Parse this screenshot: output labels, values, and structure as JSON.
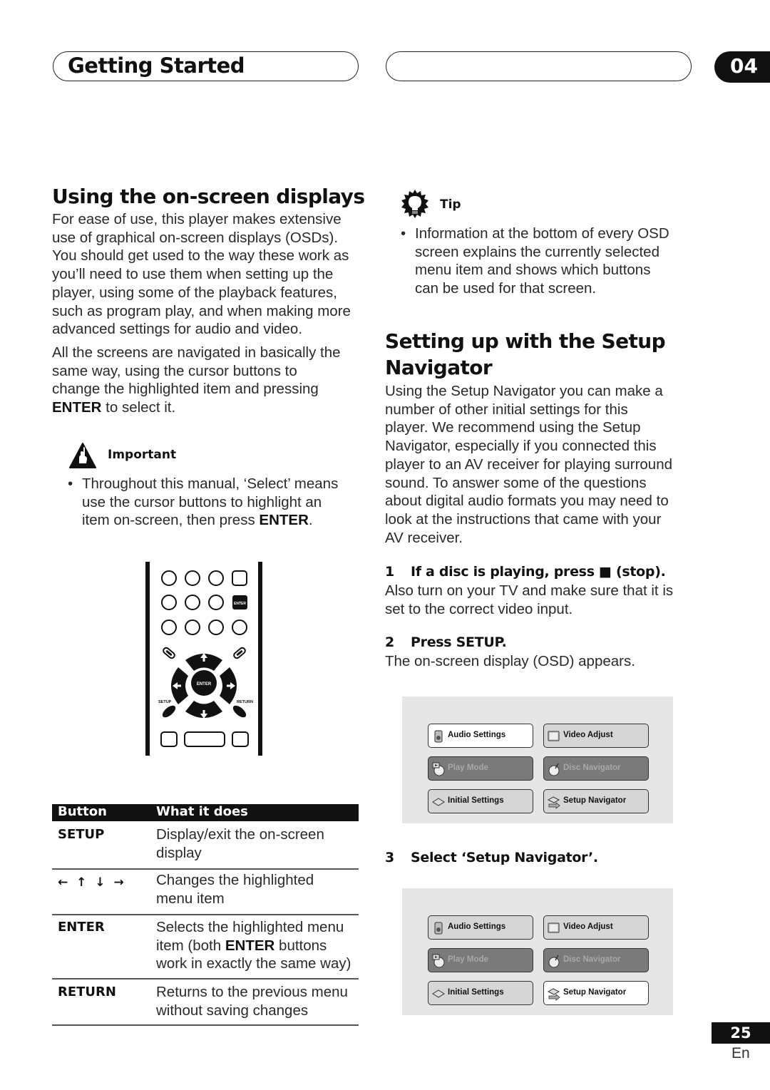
{
  "header": {
    "section_title": "Getting Started",
    "chapter_number": "04"
  },
  "left": {
    "heading": "Using the on-screen displays",
    "para1": "For ease of use, this player makes extensive use of graphical on-screen displays (OSDs). You should get used to the way these work as you’ll need to use them when setting up the player, using some of the playback features, such as program play, and when making more advanced settings for audio and video.",
    "para2_lines": [
      "All the screens are navigated in basically the",
      "same way, using the cursor buttons to",
      "change the highlighted item and pressing"
    ],
    "para2_enter": "ENTER",
    "para2_tail": " to select it.",
    "important_icon": "warning-hand-icon",
    "important_label": "Important",
    "important_bullet": {
      "line1": "Throughout this manual, ‘Select’ means",
      "line2": "use the cursor buttons to highlight an",
      "line3_pre": "item on-screen, then press ",
      "line3_bold": "ENTER",
      "line3_post": "."
    },
    "remote": {
      "enter_small_label": "ENTER",
      "enter_center_label": "ENTER",
      "setup_label": "SETUP",
      "return_label": "RETURN"
    },
    "table": {
      "headers": [
        "Button",
        "What it does"
      ],
      "rows": [
        {
          "key": "SETUP",
          "lines": [
            "Display/exit the on-screen",
            "display"
          ]
        },
        {
          "key": "arrows",
          "key_symbols": "← ↑ ↓ →",
          "lines": [
            "Changes the highlighted",
            "menu item"
          ]
        },
        {
          "key": "ENTER",
          "line1": "Selects the highlighted menu",
          "line2_pre": "item (both ",
          "line2_bold": "ENTER",
          "line2_post": " buttons",
          "line3": "work in exactly the same way)"
        },
        {
          "key": "RETURN",
          "lines": [
            "Returns to the previous menu",
            "without saving changes"
          ]
        }
      ]
    }
  },
  "right": {
    "tip_icon": "lightbulb-icon",
    "tip_label": "Tip",
    "tip_bullet": [
      "Information at the bottom of every OSD",
      "screen explains the currently selected",
      "menu item and shows which buttons",
      "can be used for that screen."
    ],
    "heading_line1": "Setting up with the Setup",
    "heading_line2": "Navigator",
    "intro": [
      "Using the Setup Navigator you can make a",
      "number of other initial settings for this",
      "player. We recommend using the Setup",
      "Navigator, especially if you connected this",
      "player to an AV receiver for playing surround",
      "sound. To answer some of the questions",
      "about digital audio formats you may need to",
      "look at the instructions that came with your",
      "AV receiver."
    ],
    "step1": {
      "num": "1",
      "title_pre": "If a disc is playing, press ",
      "title_symbol": "■",
      "title_post": " (stop).",
      "body": [
        "Also turn on your TV and make sure that it is",
        "set to the correct video input."
      ]
    },
    "step2": {
      "num": "2",
      "title": "Press SETUP.",
      "body": [
        "The on-screen display (OSD) appears."
      ]
    },
    "step3": {
      "num": "3",
      "title": "Select ‘Setup Navigator’."
    },
    "osd1": {
      "items": [
        {
          "label": "Audio Settings",
          "icon": "speaker-icon",
          "state": "selected"
        },
        {
          "label": "Video Adjust",
          "icon": "monitor-icon",
          "state": "normal"
        },
        {
          "label": "Play Mode",
          "icon": "disc-play-icon",
          "state": "disabled"
        },
        {
          "label": "Disc Navigator",
          "icon": "disc-navigator-icon",
          "state": "disabled"
        },
        {
          "label": "Initial Settings",
          "icon": "player-icon",
          "state": "normal"
        },
        {
          "label": "Setup Navigator",
          "icon": "setup-navigator-icon",
          "state": "normal"
        }
      ]
    },
    "osd2": {
      "items": [
        {
          "label": "Audio Settings",
          "icon": "speaker-icon",
          "state": "normal"
        },
        {
          "label": "Video Adjust",
          "icon": "monitor-icon",
          "state": "normal"
        },
        {
          "label": "Play Mode",
          "icon": "disc-play-icon",
          "state": "disabled"
        },
        {
          "label": "Disc Navigator",
          "icon": "disc-navigator-icon",
          "state": "disabled"
        },
        {
          "label": "Initial Settings",
          "icon": "player-icon",
          "state": "normal"
        },
        {
          "label": "Setup Navigator",
          "icon": "setup-navigator-icon",
          "state": "selected"
        }
      ]
    }
  },
  "footer": {
    "page_number": "25",
    "language": "En"
  },
  "colors": {
    "ink": "#111111",
    "osd_background": "#e6e6e6",
    "osd_button": "#d6d6d6",
    "osd_button_selected": "#ffffff",
    "osd_button_disabled": "#7a7a7a"
  }
}
